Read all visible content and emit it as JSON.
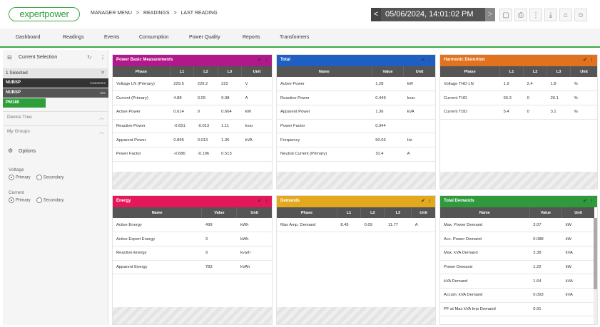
{
  "app": {
    "logo_text": "expertpower"
  },
  "breadcrumb": [
    "MANAGER MENU",
    ">",
    "READINGS",
    ">",
    "LAST READING"
  ],
  "date": {
    "value": "05/06/2024, 14:01:02 PM",
    "prev": "<",
    "next": ">"
  },
  "toolbar_icons": [
    "file-icon",
    "print-icon",
    "more-icon",
    "download-icon",
    "home-icon",
    "user-icon"
  ],
  "toolbar_glyphs": [
    "▢",
    "⎙",
    "⋮",
    "⤓",
    "⌂",
    "☺"
  ],
  "nav": [
    "Dashboard",
    "Readings",
    "Events",
    "Consumption",
    "Power Quality",
    "Reports",
    "Transformers"
  ],
  "sidebar": {
    "title": "Current Selection",
    "selected": "1 Selected",
    "tree": [
      {
        "label": "NUBSP",
        "tag": "Customers"
      },
      {
        "label": "NUBSP",
        "tag": "Site"
      },
      {
        "label": "PM180",
        "tag": ""
      }
    ],
    "links": [
      "Device Tree",
      "My Groups"
    ],
    "options_title": "Options",
    "voltage": {
      "label": "Voltage",
      "options": [
        "Primary",
        "Secondary"
      ],
      "selected": "Primary"
    },
    "current": {
      "label": "Current",
      "options": [
        "Primary",
        "Secondary"
      ],
      "selected": "Primary"
    }
  },
  "colors": {
    "basic": "#b0188c",
    "total": "#1f5fc4",
    "harmonic": "#e2721e",
    "energy": "#e3175a",
    "demands": "#e3a81c",
    "total_demands": "#2f9a3c",
    "accent": "#3aa845"
  },
  "panels": {
    "basic": {
      "title": "Power Basic Measurements",
      "columns": [
        "Phase",
        "L1",
        "L2",
        "L3",
        "Unit"
      ],
      "rows": [
        [
          "Voltage LN (Primary)",
          "229.5",
          "229.2",
          "222",
          "V"
        ],
        [
          "Current (Primary)",
          "4.88",
          "0.09",
          "9.98",
          "A"
        ],
        [
          "Active Power",
          "0.614",
          "0",
          "0.664",
          "kW"
        ],
        [
          "Reactive Power",
          "-0.651",
          "-0.013",
          "1.11",
          "kvar"
        ],
        [
          "Apparent Power",
          "0.895",
          "0.013",
          "1.36",
          "kVA"
        ],
        [
          "Power Factor",
          "-0.686",
          "-0.196",
          "0.513",
          ""
        ]
      ]
    },
    "total": {
      "title": "Total",
      "columns": [
        "Name",
        "Value",
        "Unit"
      ],
      "rows": [
        [
          "Active Power",
          "1.28",
          "kW"
        ],
        [
          "Reactive Power",
          "0.449",
          "kvar"
        ],
        [
          "Apparent Power",
          "1.36",
          "kVA"
        ],
        [
          "Power Factor",
          "0.944",
          ""
        ],
        [
          "Frequency",
          "50.03",
          "Hz"
        ],
        [
          "Neutral Current (Primary)",
          "10.4",
          "A"
        ]
      ]
    },
    "harmonic": {
      "title": "Harmonic Distortion",
      "columns": [
        "Phase",
        "L1",
        "L2",
        "L3",
        "Unit"
      ],
      "rows": [
        [
          "Voltage THD LN",
          "1.9",
          "2.4",
          "1.8",
          "%"
        ],
        [
          "Current THD",
          "66.3",
          "0",
          "26.1",
          "%"
        ],
        [
          "Current TDD",
          "5.4",
          "0",
          "3.1",
          "%"
        ]
      ]
    },
    "energy": {
      "title": "Energy",
      "columns": [
        "Name",
        "Value",
        "Unit"
      ],
      "rows": [
        [
          "Active Energy",
          "499",
          "kWh"
        ],
        [
          "Active Export Energy",
          "3",
          "kWh"
        ],
        [
          "Reactive Energy",
          "9",
          "kvarh"
        ],
        [
          "Apparent Energy",
          "783",
          "kVAh"
        ]
      ]
    },
    "demands": {
      "title": "Demands",
      "columns": [
        "Phase",
        "L1",
        "L2",
        "L3",
        "Unit"
      ],
      "rows": [
        [
          "Max Amp. Demand",
          "8.45",
          "0.09",
          "11.77",
          "A"
        ]
      ]
    },
    "total_demands": {
      "title": "Total Demands",
      "columns": [
        "Name",
        "Value",
        "Unit"
      ],
      "rows": [
        [
          "Max. Power Demand",
          "3.07",
          "kW"
        ],
        [
          "Acc. Power Demand",
          "0.088",
          "kW"
        ],
        [
          "Max. kVA Demand",
          "3.38",
          "kVA"
        ],
        [
          "Power Demand",
          "1.22",
          "kW"
        ],
        [
          "kVA Demand",
          "1.64",
          "kVA"
        ],
        [
          "Accum. kVA Demand",
          "0.093",
          "kVA"
        ],
        [
          "PF at Max kVA Imp Demand",
          "0.91",
          ""
        ]
      ]
    }
  }
}
